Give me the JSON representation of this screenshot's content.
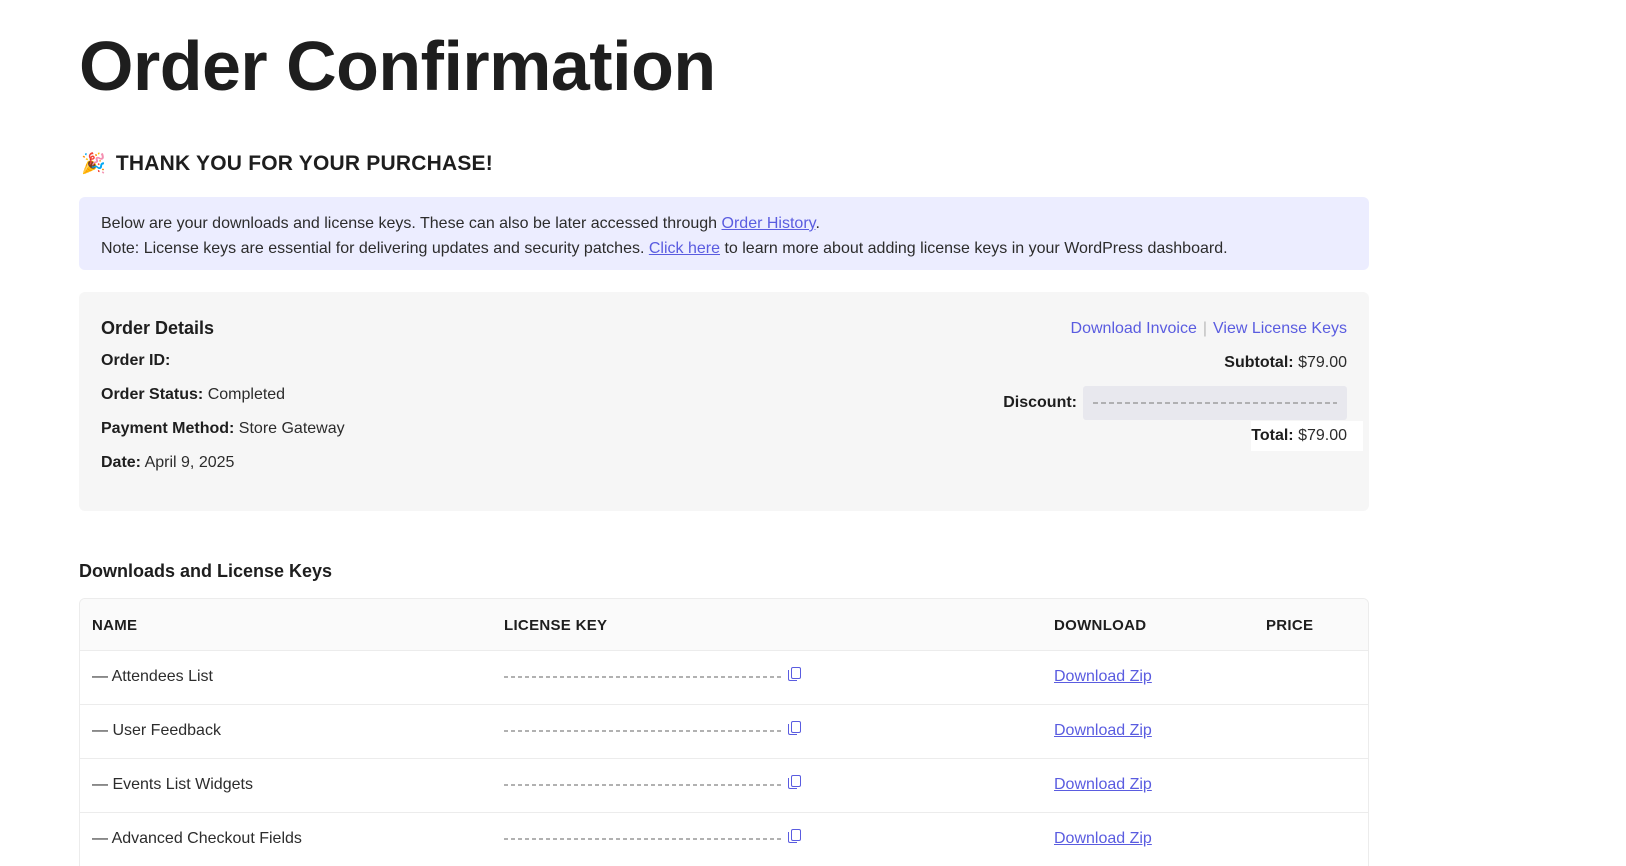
{
  "page": {
    "title": "Order Confirmation"
  },
  "thanks": {
    "icon": "party-popper-icon",
    "glyph": "🎉",
    "text": "THANK YOU FOR YOUR PURCHASE!"
  },
  "notice": {
    "line1_pre": "Below are your downloads and license keys. These can also be later accessed through ",
    "line1_link": "Order History",
    "line1_post": ".",
    "line2_pre": "Note: License keys are essential for delivering updates and security patches. ",
    "line2_link": "Click here",
    "line2_post": " to learn more about adding license keys in your WordPress dashboard."
  },
  "order": {
    "title": "Order Details",
    "id_label": "Order ID:",
    "id_value": "",
    "status_label": "Order Status:",
    "status_value": "Completed",
    "payment_label": "Payment Method:",
    "payment_value": "Store Gateway",
    "date_label": "Date:",
    "date_value": "April 9, 2025",
    "download_invoice": "Download Invoice",
    "separator": "|",
    "view_license_keys": "View License Keys",
    "subtotal_label": "Subtotal:",
    "subtotal_value": "$79.00",
    "discount_label": "Discount:",
    "total_label": "Total:",
    "total_value": "$79.00"
  },
  "downloads": {
    "title": "Downloads and License Keys",
    "columns": {
      "name": "NAME",
      "license": "LICENSE KEY",
      "download": "DOWNLOAD",
      "price": "PRICE"
    },
    "rows": [
      {
        "name": "— Attendees List",
        "download": "Download Zip",
        "price": ""
      },
      {
        "name": "— User Feedback",
        "download": "Download Zip",
        "price": ""
      },
      {
        "name": "— Events List Widgets",
        "download": "Download Zip",
        "price": ""
      },
      {
        "name": "— Advanced Checkout Fields",
        "download": "Download Zip",
        "price": ""
      }
    ]
  },
  "colors": {
    "accent": "#5a5ce0",
    "notice_bg": "#ecedff",
    "panel_bg": "#f6f6f6"
  }
}
